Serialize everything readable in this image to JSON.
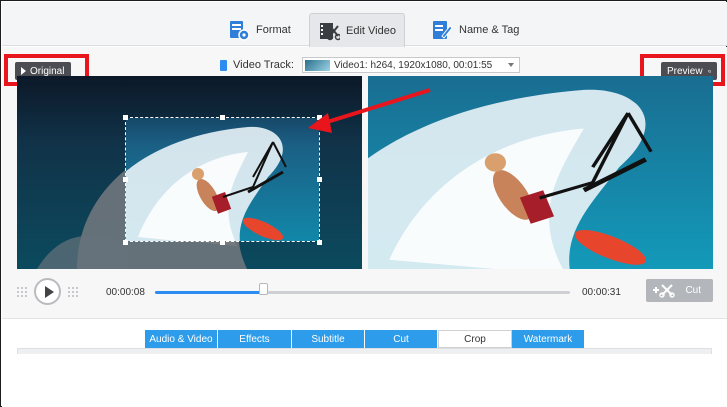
{
  "top_tabs": [
    {
      "label": "Format",
      "icon": "format-icon"
    },
    {
      "label": "Edit Video",
      "icon": "edit-video-icon",
      "active": true
    },
    {
      "label": "Name & Tag",
      "icon": "name-tag-icon"
    }
  ],
  "original_label": "Original",
  "preview_label": "Preview",
  "video_track": {
    "label": "Video Track:",
    "selected": "Video1: h264, 1920x1080, 00:01:55"
  },
  "playback": {
    "current_time": "00:00:08",
    "end_time": "00:00:31",
    "progress": 0.26,
    "cut_label": "Cut"
  },
  "edit_tabs": [
    {
      "label": "Audio & Video"
    },
    {
      "label": "Effects"
    },
    {
      "label": "Subtitle"
    },
    {
      "label": "Cut"
    },
    {
      "label": "Crop",
      "active": true
    },
    {
      "label": "Watermark"
    }
  ],
  "colors": {
    "accent": "#2d9cea",
    "highlight": "#e8161c",
    "badge": "#4b4d52"
  }
}
